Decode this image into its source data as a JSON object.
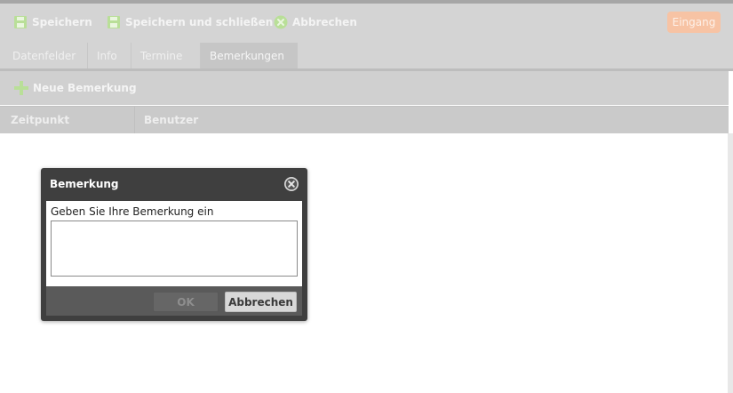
{
  "toolbar": {
    "save_label": "Speichern",
    "save_close_label": "Speichern und schließen",
    "cancel_label": "Abbrechen",
    "status_badge": "Eingang"
  },
  "tabs": [
    {
      "label": "Datenfelder"
    },
    {
      "label": "Info"
    },
    {
      "label": "Termine"
    },
    {
      "label": "Bemerkungen",
      "active": true
    }
  ],
  "subtoolbar": {
    "new_note_label": "Neue Bemerkung"
  },
  "table": {
    "columns": [
      "Zeitpunkt",
      "Benutzer"
    ]
  },
  "dialog": {
    "title": "Bemerkung",
    "prompt": "Geben Sie Ihre Bemerkung ein",
    "input_value": "",
    "ok_label": "OK",
    "cancel_label": "Abbrechen"
  },
  "colors": {
    "overlay_gray": "#d4d4d4",
    "badge_orange": "#f7c3a4",
    "icon_green": "#b9df98",
    "dialog_dark": "#3f3f3f"
  }
}
